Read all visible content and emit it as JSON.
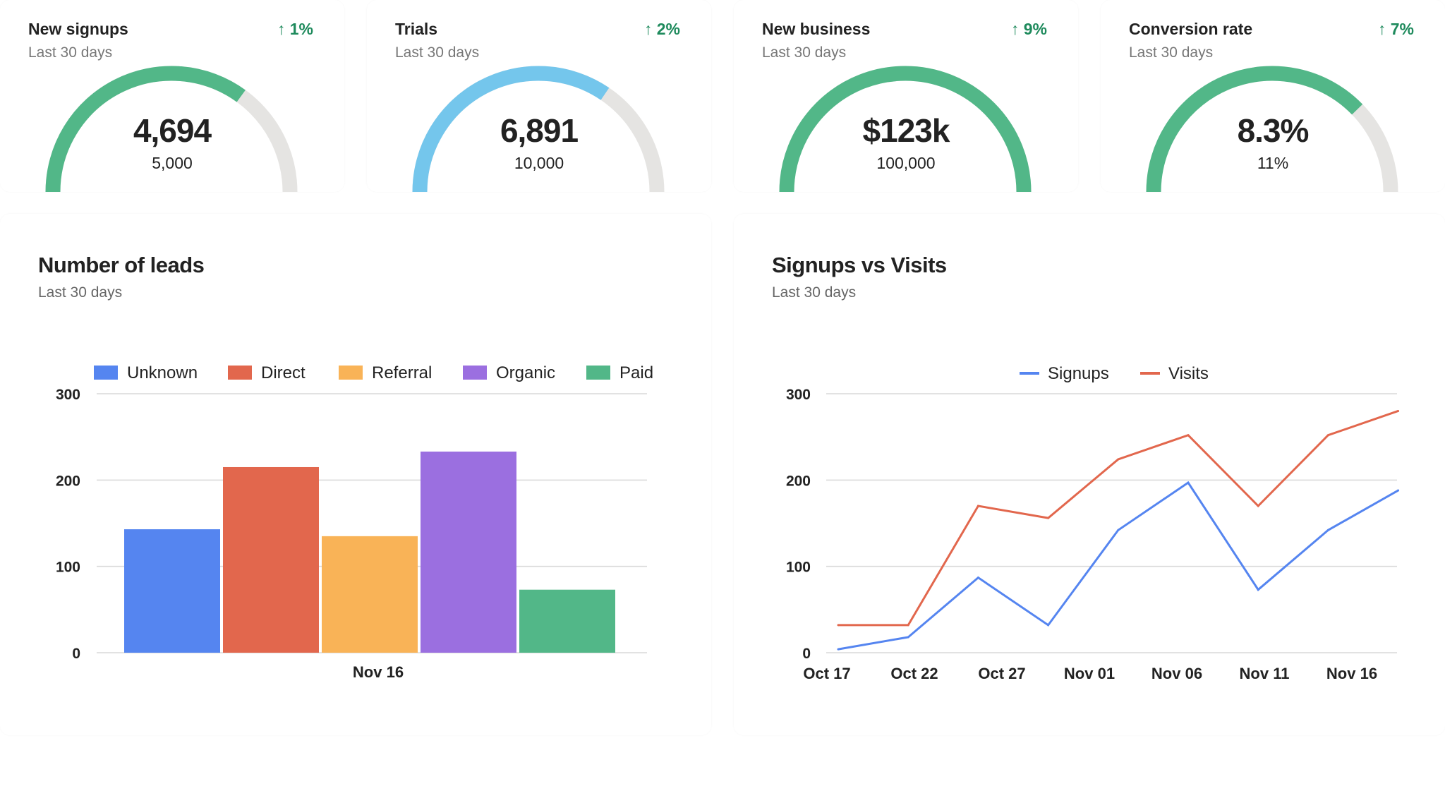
{
  "kpis": [
    {
      "title": "New signups",
      "subtitle": "Last 30 days",
      "delta": "1%",
      "value": "4,694",
      "target": "5,000",
      "fill": 0.7,
      "color": "#52b788"
    },
    {
      "title": "Trials",
      "subtitle": "Last 30 days",
      "delta": "2%",
      "value": "6,891",
      "target": "10,000",
      "fill": 0.69,
      "color": "#74c6ec"
    },
    {
      "title": "New business",
      "subtitle": "Last 30 days",
      "delta": "9%",
      "value": "$123k",
      "target": "100,000",
      "fill": 1.0,
      "color": "#52b788"
    },
    {
      "title": "Conversion rate",
      "subtitle": "Last 30 days",
      "delta": "7%",
      "value": "8.3%",
      "target": "11%",
      "fill": 0.755,
      "color": "#52b788"
    }
  ],
  "delta_arrow": "↑",
  "gauge_track_color": "#e5e4e2",
  "leads": {
    "title": "Number of leads",
    "subtitle": "Last 30 days",
    "chart_data": {
      "type": "bar",
      "categories": [
        "Nov 16"
      ],
      "series": [
        {
          "name": "Unknown",
          "values": [
            143
          ],
          "color": "#5585f0"
        },
        {
          "name": "Direct",
          "values": [
            215
          ],
          "color": "#e2674d"
        },
        {
          "name": "Referral",
          "values": [
            135
          ],
          "color": "#f9b357"
        },
        {
          "name": "Organic",
          "values": [
            233
          ],
          "color": "#9b6fe0"
        },
        {
          "name": "Paid",
          "values": [
            73
          ],
          "color": "#52b788"
        }
      ],
      "ylim": [
        0,
        300
      ],
      "yticks": [
        "0",
        "100",
        "200",
        "300"
      ],
      "grid": true,
      "legend": "top"
    }
  },
  "signups_visits": {
    "title": "Signups vs Visits",
    "subtitle": "Last 30 days",
    "chart_data": {
      "type": "line",
      "x": [
        "Oct 17",
        "Oct 21",
        "Oct 25",
        "Oct 29",
        "Nov 02",
        "Nov 06",
        "Nov 10",
        "Nov 14",
        "Nov 18"
      ],
      "xticks": [
        "Oct 17",
        "Oct 22",
        "Oct 27",
        "Nov 01",
        "Nov 06",
        "Nov 11",
        "Nov 16"
      ],
      "series": [
        {
          "name": "Signups",
          "values": [
            4,
            18,
            87,
            32,
            142,
            197,
            73,
            142,
            188
          ],
          "color": "#5585f0"
        },
        {
          "name": "Visits",
          "values": [
            32,
            32,
            170,
            156,
            224,
            252,
            170,
            252,
            280
          ],
          "color": "#e2674d"
        }
      ],
      "ylim": [
        0,
        300
      ],
      "yticks": [
        "0",
        "100",
        "200",
        "300"
      ],
      "grid": true,
      "legend": "top"
    }
  }
}
